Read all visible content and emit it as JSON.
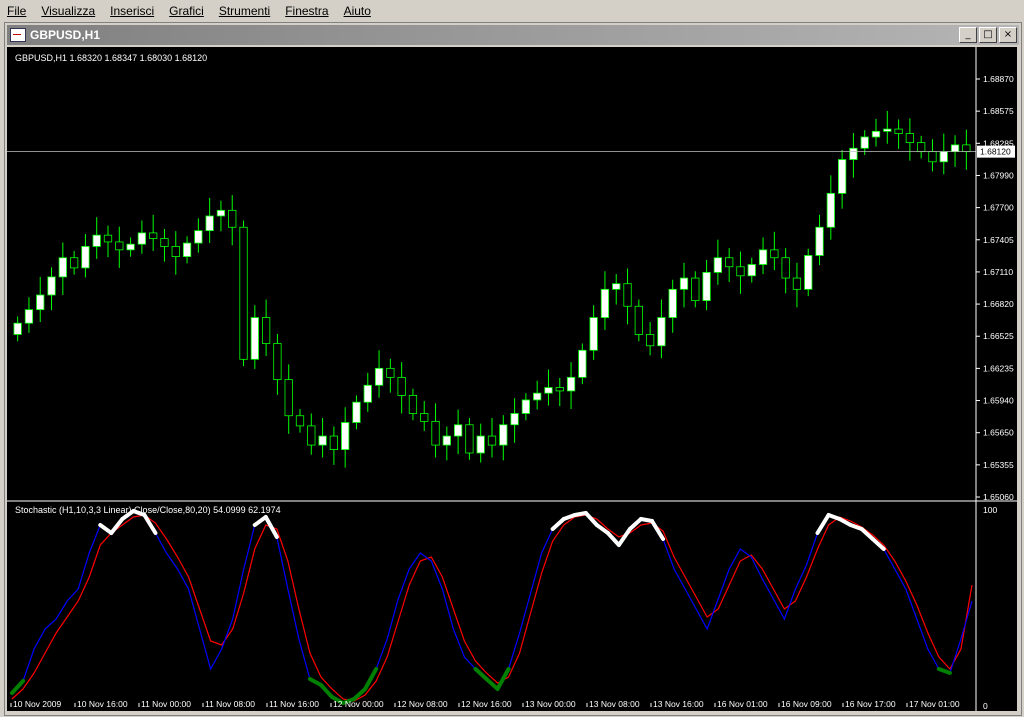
{
  "menu": [
    "File",
    "Visualizza",
    "Inserisci",
    "Grafici",
    "Strumenti",
    "Finestra",
    "Aiuto"
  ],
  "window": {
    "title": "GBPUSD,H1",
    "min_glyph": "_",
    "max_glyph": "□",
    "close_glyph": "×"
  },
  "price_panel": {
    "header": "GBPUSD,H1  1.68320 1.68347 1.68030 1.68120",
    "price_axis": [
      "1.68870",
      "1.68575",
      "1.68285",
      "1.67990",
      "1.67700",
      "1.67405",
      "1.67110",
      "1.66820",
      "1.66525",
      "1.66235",
      "1.65940",
      "1.65650",
      "1.65355",
      "1.65060"
    ],
    "current_price": "1.68120"
  },
  "stoch_panel": {
    "header": "Stochastic (H1,10,3,3 Linear) Close/Close,80,20) 54.0999 62.1974",
    "axis": [
      "100",
      "0"
    ]
  },
  "time_axis": [
    "10 Nov 2009",
    "10 Nov 16:00",
    "11 Nov 00:00",
    "11 Nov 08:00",
    "11 Nov 16:00",
    "12 Nov 00:00",
    "12 Nov 08:00",
    "12 Nov 16:00",
    "13 Nov 00:00",
    "13 Nov 08:00",
    "13 Nov 16:00",
    "16 Nov 01:00",
    "16 Nov 09:00",
    "16 Nov 17:00",
    "17 Nov 01:00"
  ],
  "colors": {
    "bull": "#ffffff",
    "bear": "#000000",
    "candle_outline": "#00ff00",
    "k_line": "#0000ff",
    "d_line": "#ff0000",
    "overbought": "#ffffff",
    "oversold": "#008000"
  },
  "chart_data": {
    "type": "candlestick",
    "symbol": "GBPUSD",
    "timeframe": "H1",
    "y_range": [
      1.6506,
      1.6887
    ],
    "ohlc_close_series": [
      1.666,
      1.6672,
      1.6685,
      1.6701,
      1.6718,
      1.6709,
      1.6728,
      1.6738,
      1.6732,
      1.6725,
      1.673,
      1.674,
      1.6735,
      1.6728,
      1.6719,
      1.6731,
      1.6742,
      1.6755,
      1.676,
      1.6745,
      1.6628,
      1.6665,
      1.6642,
      1.661,
      1.6578,
      1.6569,
      1.6552,
      1.656,
      1.6548,
      1.6572,
      1.659,
      1.6605,
      1.662,
      1.6612,
      1.6596,
      1.658,
      1.6573,
      1.6552,
      1.656,
      1.657,
      1.6545,
      1.656,
      1.6552,
      1.657,
      1.658,
      1.6592,
      1.6598,
      1.6603,
      1.66,
      1.6612,
      1.6636,
      1.6665,
      1.669,
      1.6695,
      1.6675,
      1.665,
      1.664,
      1.6665,
      1.669,
      1.67,
      1.668,
      1.6705,
      1.6718,
      1.671,
      1.6702,
      1.6712,
      1.6725,
      1.6718,
      1.67,
      1.669,
      1.672,
      1.6745,
      1.6775,
      1.6805,
      1.6815,
      1.6825,
      1.683,
      1.6832,
      1.6828,
      1.682,
      1.6812,
      1.6803,
      1.6812,
      1.6818,
      1.6812
    ],
    "stochastic": {
      "k_values": [
        8,
        14,
        30,
        40,
        45,
        54,
        60,
        78,
        92,
        88,
        95,
        99,
        97,
        88,
        78,
        70,
        60,
        40,
        20,
        30,
        45,
        70,
        92,
        96,
        86,
        60,
        35,
        15,
        12,
        6,
        3,
        5,
        10,
        20,
        35,
        55,
        70,
        78,
        74,
        60,
        40,
        26,
        20,
        15,
        10,
        20,
        38,
        58,
        78,
        90,
        95,
        97,
        98,
        92,
        88,
        82,
        90,
        95,
        94,
        85,
        70,
        60,
        50,
        40,
        55,
        70,
        80,
        76,
        65,
        55,
        45,
        60,
        72,
        88,
        97,
        95,
        92,
        90,
        85,
        80,
        70,
        60,
        45,
        30,
        20,
        18,
        35,
        54
      ],
      "d_values": [
        5,
        10,
        18,
        28,
        38,
        46,
        54,
        66,
        82,
        88,
        92,
        96,
        97,
        93,
        85,
        76,
        66,
        50,
        34,
        32,
        40,
        58,
        80,
        92,
        90,
        74,
        50,
        28,
        16,
        10,
        5,
        4,
        7,
        14,
        26,
        44,
        62,
        74,
        76,
        66,
        50,
        34,
        24,
        18,
        13,
        16,
        28,
        48,
        68,
        84,
        92,
        96,
        97,
        95,
        90,
        86,
        88,
        92,
        93,
        89,
        76,
        66,
        56,
        46,
        50,
        62,
        74,
        77,
        70,
        60,
        50,
        54,
        66,
        80,
        92,
        96,
        94,
        91,
        87,
        82,
        74,
        64,
        52,
        38,
        26,
        20,
        30,
        62
      ]
    }
  }
}
